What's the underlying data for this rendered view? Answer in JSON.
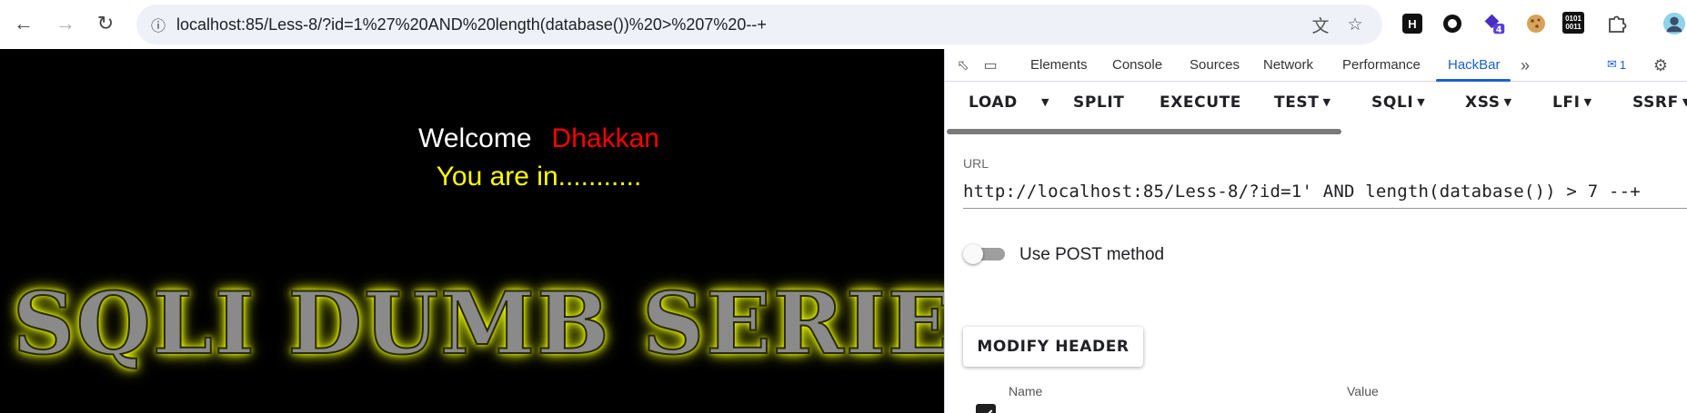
{
  "browser": {
    "address": {
      "host": "localhost",
      "path": ":85/Less-8/?id=1%27%20AND%20length(database())%20>%207%20--+"
    }
  },
  "page": {
    "welcome": "Welcome",
    "name": "Dhakkan",
    "status": "You are in...........",
    "banner": "SQLI DUMB SERIES"
  },
  "devtools": {
    "tabs": [
      "Elements",
      "Console",
      "Sources",
      "Network",
      "Performance",
      "HackBar"
    ],
    "active_tab": "HackBar",
    "message_count": "1",
    "hackbar": {
      "toolbar": {
        "load": "LOAD",
        "split": "SPLIT",
        "execute": "EXECUTE",
        "test": "TEST",
        "sqli": "SQLI",
        "xss": "XSS",
        "lfi": "LFI",
        "ssrf": "SSRF"
      },
      "url_label": "URL",
      "url_value": "http://localhost:85/Less-8/?id=1' AND length(database()) > 7 --+",
      "post_label": "Use POST method",
      "post_enabled": false,
      "modify_header": "MODIFY HEADER",
      "headers_table": {
        "name_header": "Name",
        "value_header": "Value"
      }
    }
  },
  "colors": {
    "accent": "#1a5fd0",
    "page_bg": "#000000",
    "welcome_name": "#ff0000",
    "status_text": "#ffff00",
    "banner_glow": "#ffff00"
  },
  "icons": [
    "back-icon",
    "forward-icon",
    "reload-icon",
    "site-info-icon",
    "translate-icon",
    "bookmark-star-icon",
    "extension-h-icon",
    "extension-circle-icon",
    "extension-badge-icon",
    "cookie-icon",
    "binary-icon",
    "puzzle-icon",
    "inspect-icon",
    "device-toolbar-icon",
    "more-tabs-icon",
    "message-icon",
    "settings-gear-icon"
  ]
}
